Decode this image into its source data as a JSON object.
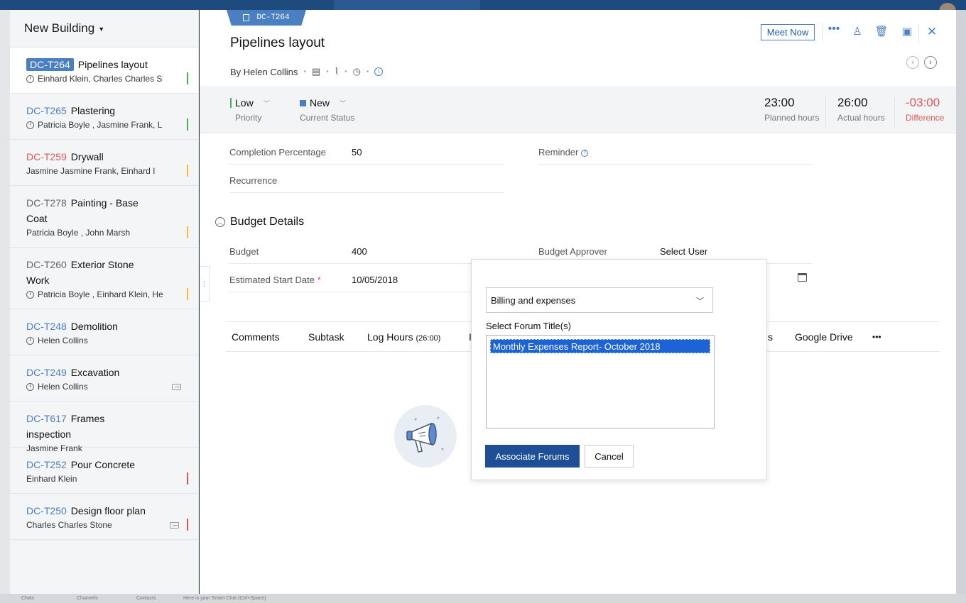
{
  "sidebar": {
    "project_title": "New Building",
    "tasks": [
      {
        "id": "DC-T264",
        "title": "Pipelines layout",
        "assignees": "Einhard Klein, Charles Charles St",
        "clock": true,
        "flag_color": "#4caf50"
      },
      {
        "id": "DC-T265",
        "title": "Plastering",
        "assignees": "Patricia Boyle , Jasmine Frank, Li",
        "clock": true,
        "flag_color": "#4caf50"
      },
      {
        "id": "DC-T259",
        "title": "Drywall",
        "assignees": "Jasmine Jasmine Frank, Einhard I",
        "clock": false,
        "flag_color": "#f5b942"
      },
      {
        "id": "DC-T278",
        "title": "Painting - Base Coat",
        "assignees": "Patricia Boyle , John Marsh",
        "clock": false,
        "flag_color": "#f5b942"
      },
      {
        "id": "DC-T260",
        "title": "Exterior Stone Work",
        "assignees": "Patricia Boyle , Einhard Klein, He",
        "clock": true,
        "flag_color": "#f5b942"
      },
      {
        "id": "DC-T248",
        "title": "Demolition",
        "assignees": "Helen Collins",
        "clock": true
      },
      {
        "id": "DC-T249",
        "title": "Excavation",
        "assignees": "Helen Collins",
        "clock": true,
        "subtask_icon": "subtask-icon"
      },
      {
        "id": "DC-T617",
        "title": "Frames inspection",
        "assignees": "Jasmine Frank",
        "clock": false
      },
      {
        "id": "DC-T252",
        "title": "Pour Concrete",
        "assignees": "Einhard Klein",
        "clock": false,
        "flag_color": "#e05656"
      },
      {
        "id": "DC-T250",
        "title": "Design floor plan",
        "assignees": "Charles Charles Stone",
        "clock": false,
        "flag_color": "#e05656",
        "subtask_icon": "subtask-icon"
      }
    ]
  },
  "task": {
    "id": "DC-T264",
    "title": "Pipelines layout",
    "byline": "By Helen Collins",
    "priority": {
      "value": "Low",
      "label": "Priority",
      "color": "#4caf50"
    },
    "status": {
      "value": "New",
      "label": "Current Status",
      "color": "#4a7fc1"
    },
    "planned": {
      "value": "23:00",
      "label": "Planned hours"
    },
    "actual": {
      "value": "26:00",
      "label": "Actual hours"
    },
    "difference": {
      "value": "-03:00",
      "label": "Difference",
      "color": "#e05656"
    }
  },
  "header": {
    "meet_now": "Meet Now",
    "icons": [
      "more-icon",
      "user-icon",
      "trash-icon",
      "template-icon",
      "close-icon"
    ]
  },
  "fields": {
    "completion_label": "Completion Percentage",
    "completion_value": "50",
    "reminder_label": "Reminder",
    "recurrence_label": "Recurrence",
    "budget_section": "Budget Details",
    "budget_label": "Budget",
    "budget_value": "400",
    "approver_label": "Budget Approver",
    "approver_value": "Select User",
    "start_label": "Estimated Start Date",
    "start_required": "*",
    "start_value": "10/05/2018"
  },
  "tabs": {
    "comments": "Comments",
    "subtask": "Subtask",
    "log_hours": "Log Hours",
    "log_hours_count": "(26:00)",
    "partial_left": "I",
    "partial_right": "s",
    "google_drive": "Google Drive",
    "more": "•••"
  },
  "modal": {
    "selected_category": "Billing and expenses",
    "forum_label": "Select Forum Title(s)",
    "forum_option": "Monthly Expenses Report- October 2018",
    "associate_button": "Associate Forums",
    "cancel_button": "Cancel"
  },
  "bottom": {
    "chats": "Chats",
    "channels": "Channels",
    "contacts": "Contacts",
    "smart_chat": "Here is your Smart Chat (Ctrl+Space)"
  },
  "colors": {
    "accent": "#4a7fc1",
    "primary_button": "#1e4f96",
    "danger": "#e05656"
  }
}
